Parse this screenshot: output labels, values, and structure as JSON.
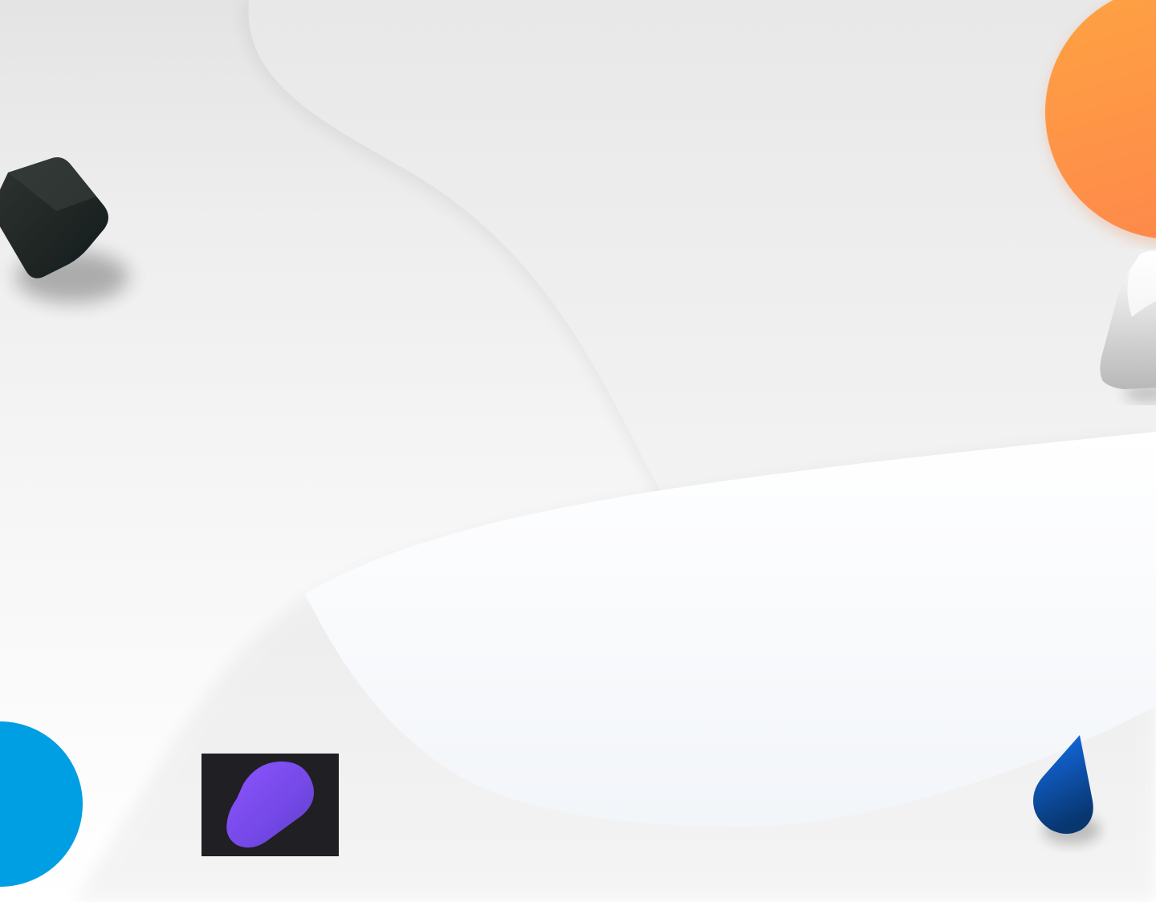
{
  "scene": {
    "description_free": true,
    "colors": {
      "background_top": "#e6e6e6",
      "background_mid": "#f6f6f6",
      "background_bottom": "#ffffff",
      "wave_light": "#f3f5f8",
      "orange": "#fe9446",
      "blue_circle": "#009fe3",
      "purple": "#7b4fee",
      "dark_tile": "#201f24",
      "cube": "#202624",
      "drop_top": "#1167e8",
      "drop_bottom": "#0a3f86",
      "white_block": "#f1f1f1"
    },
    "shapes": [
      {
        "name": "dark-cube-shape",
        "color": "#202624"
      },
      {
        "name": "orange-sphere-shape",
        "color": "#fe9446"
      },
      {
        "name": "white-block-shape",
        "color": "#f1f1f1"
      },
      {
        "name": "blue-circle-shape",
        "color": "#009fe3"
      },
      {
        "name": "purple-pill-tile",
        "color": "#7b4fee"
      },
      {
        "name": "blue-drop-shape",
        "color": "#1167e8"
      }
    ]
  }
}
